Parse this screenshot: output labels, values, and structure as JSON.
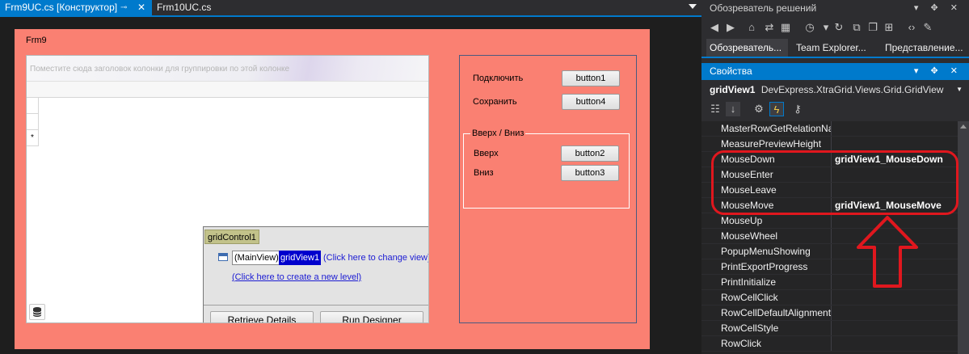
{
  "editor": {
    "tabs": [
      {
        "label": "Frm9UC.cs [Конструктор]",
        "pin": "⊸",
        "close": "✕"
      },
      {
        "label": "Frm10UC.cs"
      }
    ]
  },
  "form": {
    "title": "Frm9",
    "grid": {
      "group_panel_hint": "Поместите сюда заголовок колонки для группировки по этой колонке",
      "new_row_marker": "*"
    },
    "designer_panel": {
      "control_name": "gridControl1",
      "main_view_tag": "(MainView)",
      "view_name": "gridView1",
      "change_view_link": "(Click here to change view)",
      "new_level_link": "(Click here to create a new level)",
      "retrieve_details_button": "Retrieve Details",
      "run_designer_button": "Run Designer"
    },
    "side_panel": {
      "connect_label": "Подключить",
      "save_label": "Сохранить",
      "button1": "button1",
      "button4": "button4",
      "group_title": "Вверх / Вниз",
      "up_label": "Вверх",
      "down_label": "Вниз",
      "button2": "button2",
      "button3": "button3"
    }
  },
  "solution_explorer": {
    "title": "Обозреватель решений",
    "tabs": [
      "Обозреватель...",
      "Team Explorer...",
      "Представление..."
    ]
  },
  "properties": {
    "title": "Свойства",
    "object_name": "gridView1",
    "object_type": "DevExpress.XtraGrid.Views.Grid.GridView",
    "rows": [
      {
        "name": "MasterRowGetRelationNa",
        "value": ""
      },
      {
        "name": "MeasurePreviewHeight",
        "value": ""
      },
      {
        "name": "MouseDown",
        "value": "gridView1_MouseDown"
      },
      {
        "name": "MouseEnter",
        "value": ""
      },
      {
        "name": "MouseLeave",
        "value": ""
      },
      {
        "name": "MouseMove",
        "value": "gridView1_MouseMove"
      },
      {
        "name": "MouseUp",
        "value": ""
      },
      {
        "name": "MouseWheel",
        "value": ""
      },
      {
        "name": "PopupMenuShowing",
        "value": ""
      },
      {
        "name": "PrintExportProgress",
        "value": ""
      },
      {
        "name": "PrintInitialize",
        "value": ""
      },
      {
        "name": "RowCellClick",
        "value": ""
      },
      {
        "name": "RowCellDefaultAlignment",
        "value": ""
      },
      {
        "name": "RowCellStyle",
        "value": ""
      },
      {
        "name": "RowClick",
        "value": ""
      }
    ]
  },
  "colors": {
    "form_background": "#fa8072",
    "accent": "#007acc",
    "annotation": "#e0171e"
  }
}
